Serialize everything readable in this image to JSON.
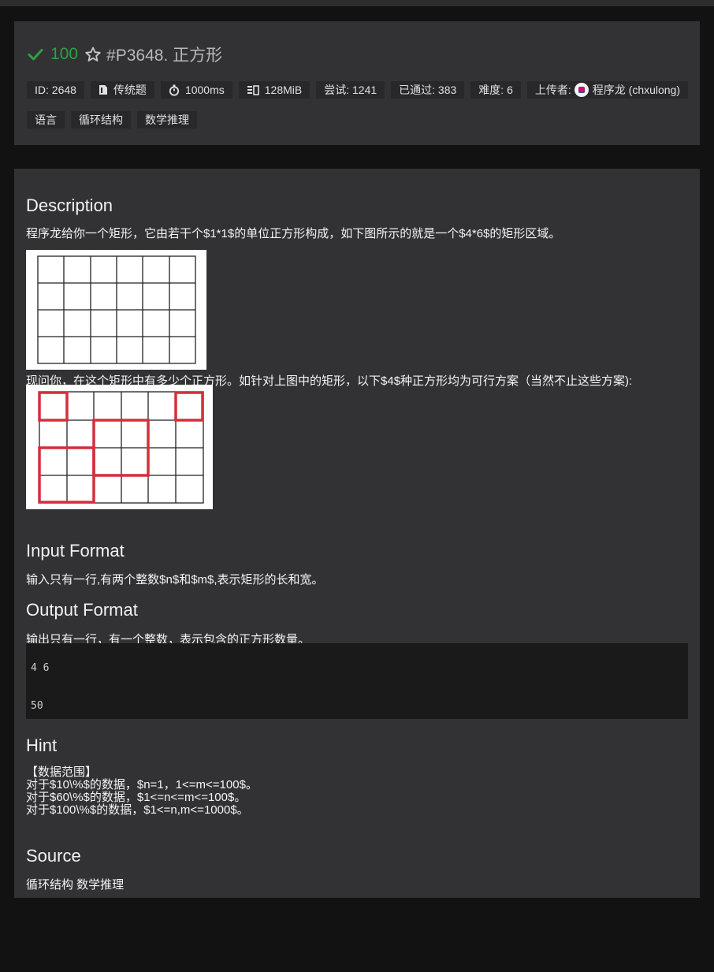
{
  "header": {
    "score": "100",
    "title": "#P3648. 正方形",
    "tags": [
      {
        "label": "ID: 2648",
        "icon": ""
      },
      {
        "label": "传统题",
        "icon": "file-icon"
      },
      {
        "label": "1000ms",
        "icon": "stopwatch-icon"
      },
      {
        "label": "128MiB",
        "icon": "memory-icon"
      },
      {
        "label": "尝试: 1241",
        "icon": ""
      },
      {
        "label": "已通过: 383",
        "icon": ""
      },
      {
        "label": "难度: 6",
        "icon": ""
      }
    ],
    "uploader_label": "上传者:",
    "uploader_name": "程序龙 (chxulong)",
    "category_tags": [
      "语言",
      "循环结构",
      "数学推理"
    ]
  },
  "content": {
    "description_heading": "Description",
    "description_text": "程序龙给你一个矩形，它由若干个$1*1$的单位正方形构成，如下图所示的就是一个$4*6$的矩形区域。",
    "question_text": "现问你，在这个矩形中有多少个正方形。如针对上图中的矩形，以下$4$种正方形均为可行方案（当然不止这些方案):",
    "input_heading": "Input Format",
    "input_text": "输入只有一行,有两个整数$n$和$m$,表示矩形的长和宽。",
    "output_heading": "Output Format",
    "output_text": "输出只有一行，有一个整数，表示包含的正方形数量。",
    "sample_input": "4 6",
    "sample_output": "50",
    "hint_heading": "Hint",
    "hint_lines": [
      "【数据范围】",
      "对于$10\\%$的数据，$n=1，1<=m<=100$。",
      "对于$60\\%$的数据，$1<=n<=m<=100$。",
      "对于$100\\%$的数据，$1<=n,m<=1000$。"
    ],
    "source_heading": "Source",
    "source_text": "循环结构 数学推理"
  },
  "colors": {
    "accent_green": "#2ea043",
    "highlight_red": "#d32f3c"
  }
}
